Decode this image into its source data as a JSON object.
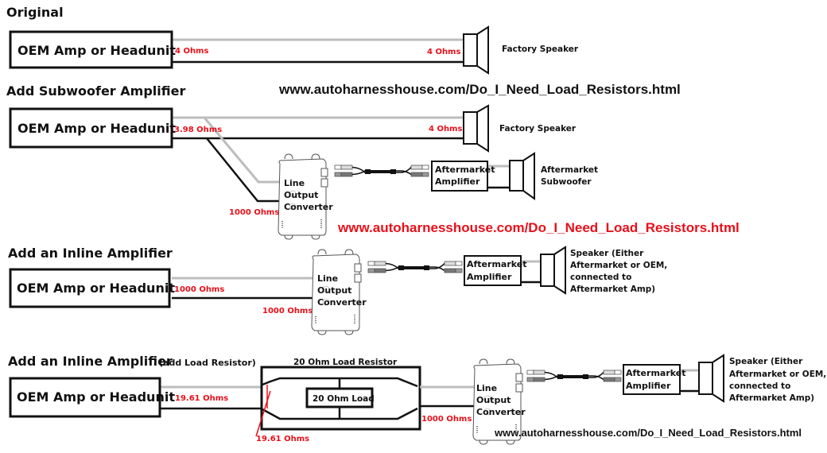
{
  "sections": [
    {
      "title": "Original",
      "source_label": "OEM Amp or Headunit",
      "source_ohms": "4 Ohms",
      "speaker_ohms": "4 Ohms",
      "speaker_label": "Factory Speaker"
    },
    {
      "title": "Add Subwoofer Amplifier",
      "source_label": "OEM Amp or Headunit",
      "source_ohms": "3.98 Ohms",
      "speaker_ohms": "4 Ohms",
      "speaker_label": "Factory Speaker",
      "converter_ohms": "1000 Ohms",
      "converter_label": [
        "Line",
        "Output",
        "Converter"
      ],
      "amp_label": [
        "Aftermarket",
        "Amplifier"
      ],
      "sub_label": [
        "Aftermarket",
        "Subwoofer"
      ]
    },
    {
      "title": "Add an Inline Amplifier",
      "source_label": "OEM Amp or Headunit",
      "source_ohms": "1000 Ohms",
      "converter_ohms": "1000 Ohms",
      "converter_label": [
        "Line",
        "Output",
        "Converter"
      ],
      "amp_label": [
        "Aftermarket",
        "Amplifier"
      ],
      "speaker_label": [
        "Speaker (Either",
        "Aftermarket or OEM,",
        "connected to",
        "Aftermarket Amp)"
      ]
    },
    {
      "title": "Add an Inline Amplifier",
      "subtitle": "(add Load Resistor)",
      "source_label": "OEM Amp or Headunit",
      "source_ohms": "19.61 Ohms",
      "resistor_title": "20 Ohm Load Resistor",
      "resistor_load": "20 Ohm Load",
      "resistor_ohms": "19.61 Ohms",
      "converter_ohms": "1000 Ohms",
      "converter_label": [
        "Line",
        "Output",
        "Converter"
      ],
      "amp_label": [
        "Aftermarket",
        "Amplifier"
      ],
      "speaker_label": [
        "Speaker (Either",
        "Aftermarket or OEM,",
        "connected to",
        "Aftermarket Amp)"
      ]
    }
  ],
  "watermarks": {
    "top": "www.autoharnesshouse.com/Do_I_Need_Load_Resistors.html",
    "middle": "www.autoharnesshouse.com/Do_I_Need_Load_Resistors.html",
    "bottom": "www.autoharnesshouse.com/Do_I_Need_Load_Resistors.html"
  },
  "colors": {
    "ohm_label": "#e8101a",
    "positive_wire": "#bdbdbd",
    "negative_wire": "#111111"
  }
}
